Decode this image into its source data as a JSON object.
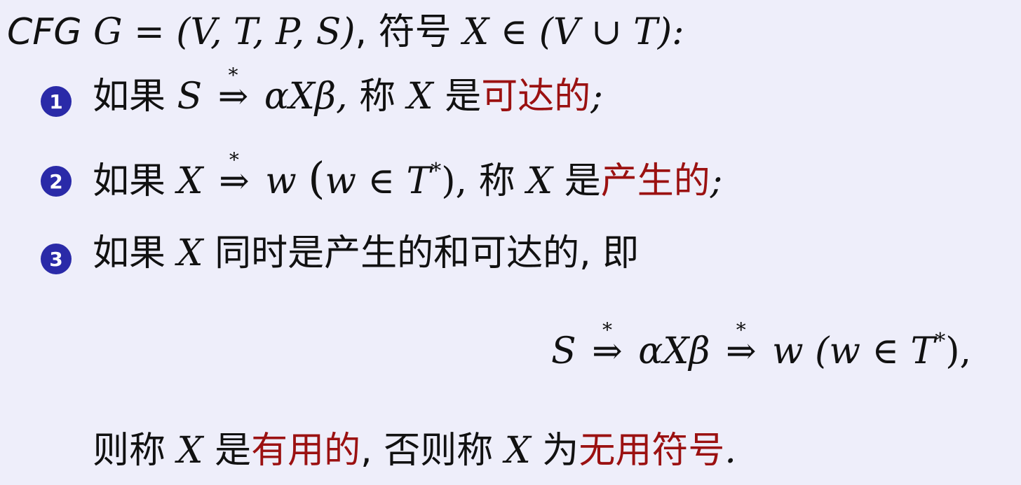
{
  "header": {
    "cfg": "CFG",
    "tuple": "G = (V, T, P, S)",
    "symbol_word": "符号",
    "membership": "X ∈ (V ∪ T):"
  },
  "items": [
    {
      "number": "1",
      "prefix": "如果",
      "formula_left": "S",
      "formula_right": "αXβ,",
      "call": "称",
      "x": "X",
      "is": "是",
      "term": "可达的",
      "end": ";"
    },
    {
      "number": "2",
      "prefix": "如果",
      "formula_left": "X",
      "formula_right": "w",
      "cond_open": "(",
      "cond": "w ∈ T",
      "cond_star": "*",
      "cond_close": "),",
      "call": "称",
      "x": "X",
      "is": "是",
      "term": "产生的",
      "end": ";"
    },
    {
      "number": "3",
      "prefix": "如果",
      "x": "X",
      "text": "同时是产生的和可达的, 即"
    }
  ],
  "display_formula": {
    "s": "S",
    "mid": "αXβ",
    "w": "w",
    "cond": "(w ∈ T",
    "cond_star": "*",
    "cond_close": "),"
  },
  "conclusion": {
    "prefix": "则称",
    "x": "X",
    "is": "是",
    "term1": "有用的",
    "mid": ", 否则称",
    "x2": "X",
    "wei": "为",
    "term2": "无用符号",
    "end": "."
  },
  "arrow_symbol": "⇒",
  "arrow_star": "*",
  "colors": {
    "background": "#eeeefa",
    "emphasis": "#9b1111",
    "bullet": "#2a2aa8"
  }
}
